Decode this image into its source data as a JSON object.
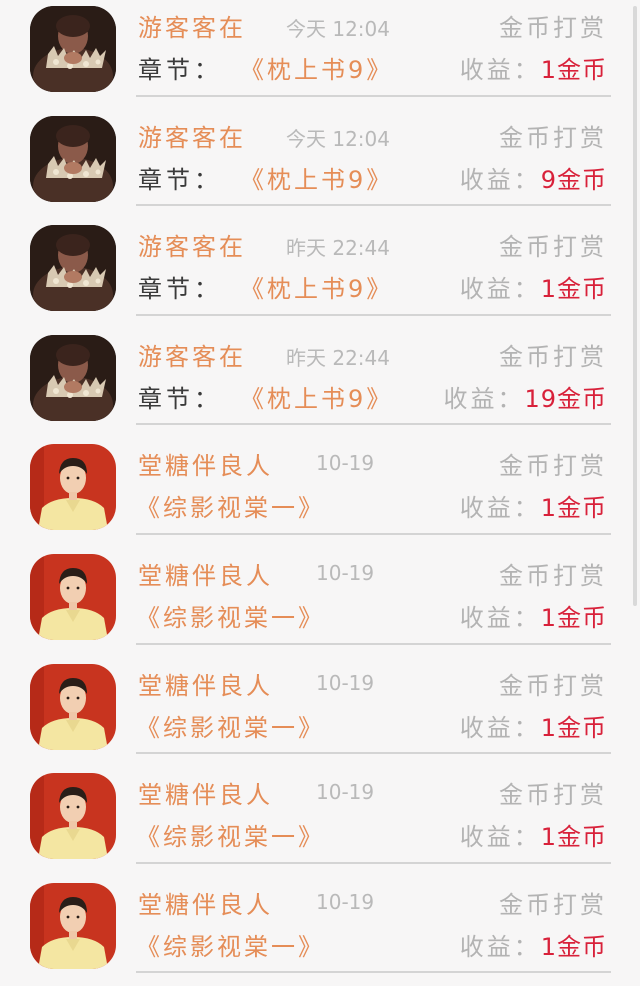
{
  "tip_label": "金币打赏",
  "chapter_label": "章节：",
  "income_label": "收益：",
  "items": [
    {
      "name": "游客客在",
      "time": "今天 12:04",
      "book": "《枕上书9》",
      "amount": "1金币",
      "avatar": "dark",
      "has_chapter": true
    },
    {
      "name": "游客客在",
      "time": "今天 12:04",
      "book": "《枕上书9》",
      "amount": "9金币",
      "avatar": "dark",
      "has_chapter": true
    },
    {
      "name": "游客客在",
      "time": "昨天 22:44",
      "book": "《枕上书9》",
      "amount": "1金币",
      "avatar": "dark",
      "has_chapter": true
    },
    {
      "name": "游客客在",
      "time": "昨天 22:44",
      "book": "《枕上书9》",
      "amount": "19金币",
      "avatar": "dark",
      "has_chapter": true
    },
    {
      "name": "堂糖伴良人",
      "time": "10-19",
      "book": "《综影视棠一》",
      "amount": "1金币",
      "avatar": "red",
      "has_chapter": false
    },
    {
      "name": "堂糖伴良人",
      "time": "10-19",
      "book": "《综影视棠一》",
      "amount": "1金币",
      "avatar": "red",
      "has_chapter": false
    },
    {
      "name": "堂糖伴良人",
      "time": "10-19",
      "book": "《综影视棠一》",
      "amount": "1金币",
      "avatar": "red",
      "has_chapter": false
    },
    {
      "name": "堂糖伴良人",
      "time": "10-19",
      "book": "《综影视棠一》",
      "amount": "1金币",
      "avatar": "red",
      "has_chapter": false
    },
    {
      "name": "堂糖伴良人",
      "time": "10-19",
      "book": "《综影视棠一》",
      "amount": "1金币",
      "avatar": "red",
      "has_chapter": false
    }
  ]
}
